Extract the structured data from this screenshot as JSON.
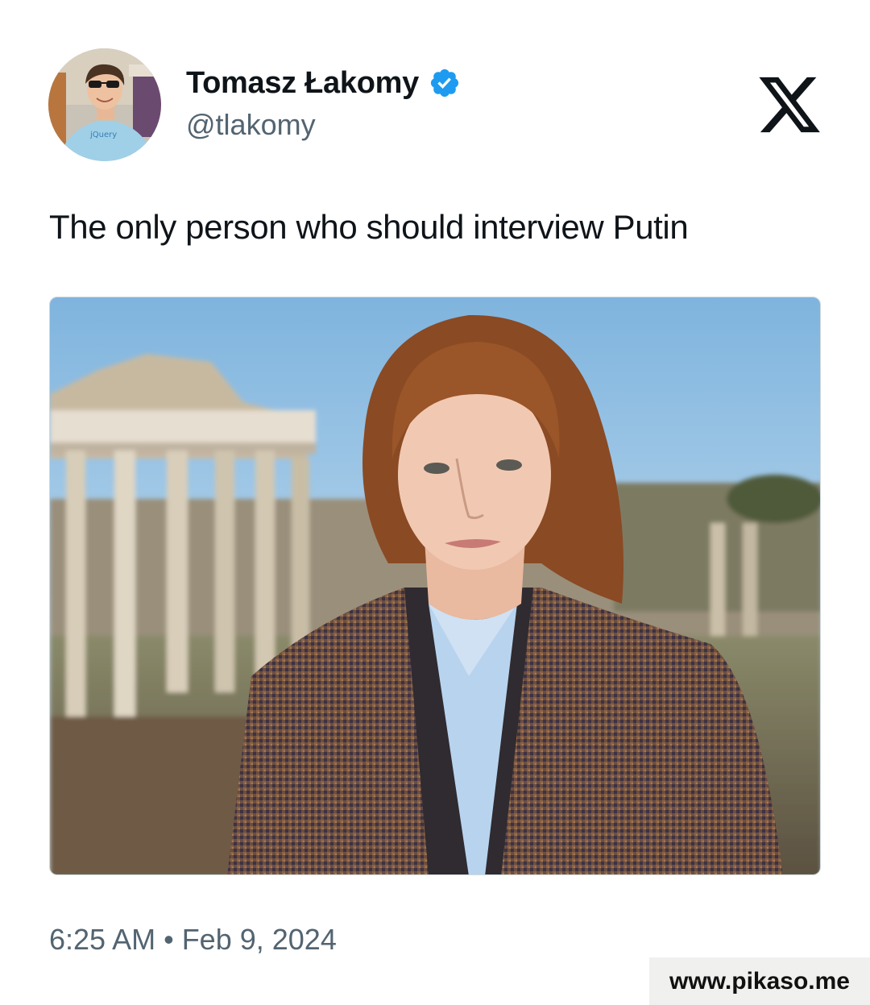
{
  "author": {
    "display_name": "Tomasz Łakomy",
    "handle": "@tlakomy",
    "avatar_icon": "user-avatar",
    "verified_icon": "verified-badge-icon",
    "verified_color": "#1d9bf0",
    "avatar_shirt_text": "jQuery"
  },
  "platform": {
    "logo_icon": "x-logo-icon"
  },
  "tweet": {
    "text": "The only person who should interview Putin",
    "timestamp": "6:25 AM • Feb 9, 2024"
  },
  "watermark": {
    "text": "www.pikaso.me"
  },
  "colors": {
    "text_primary": "#0f1419",
    "text_secondary": "#536471",
    "media_border": "#cfd9de"
  }
}
